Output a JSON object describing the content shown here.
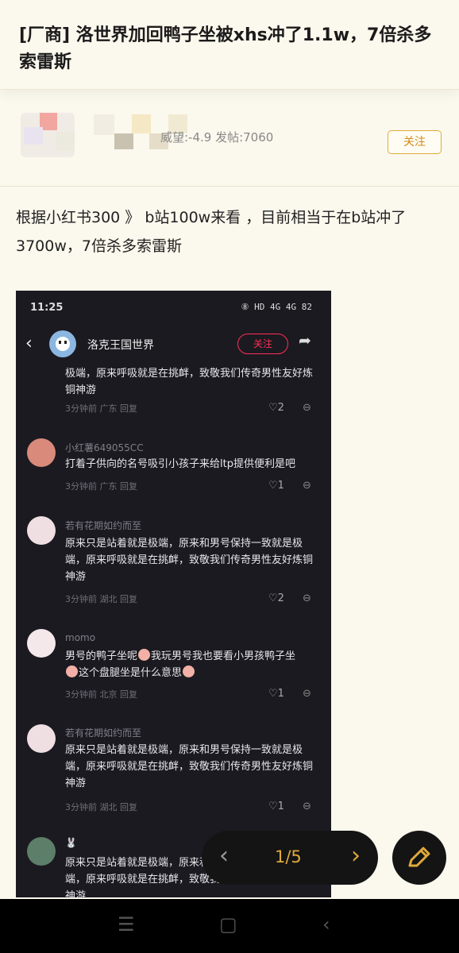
{
  "post": {
    "title": "[厂商] 洛世界加回鸭子坐被xhs冲了1.1w，7倍杀多索雷斯",
    "author_meta": "威望:-4.9 发帖:7060",
    "follow_label": "关注",
    "body": "根据小红书300 》 b站100w来看 ，目前相当于在b站冲了3700w，7倍杀多索雷斯"
  },
  "screenshot": {
    "time": "11:25",
    "status_icons": "⑧ HD 4G 4G 82",
    "account_name": "洛克王国世界",
    "follow_label": "关注",
    "comments": [
      {
        "name": "",
        "text": "极端，原来呼吸就是在挑衅，致敬我们传奇男性友好炼铜神游",
        "meta": "3分钟前 广东 回复",
        "likes": "♡2"
      },
      {
        "name": "小红薯649055CC",
        "text": "打着子供向的名号吸引小孩子来给ltp提供便利是吧",
        "meta": "3分钟前 广东 回复",
        "likes": "♡1"
      },
      {
        "name": "若有花期如约而至",
        "text": "原来只是站着就是极端，原来和男号保持一致就是极端，原来呼吸就是在挑衅，致敬我们传奇男性友好炼铜神游",
        "meta": "3分钟前 湖北 回复",
        "likes": "♡2"
      },
      {
        "name": "momo",
        "text_parts": [
          "男号的鸭子坐呢",
          "我玩男号我也要看小男孩鸭子坐",
          "这个盘腿坐是什么意思"
        ],
        "meta": "3分钟前 北京 回复",
        "likes": "♡1"
      },
      {
        "name": "若有花期如约而至",
        "text": "原来只是站着就是极端，原来和男号保持一致就是极端，原来呼吸就是在挑衅，致敬我们传奇男性友好炼铜神游",
        "meta": "3分钟前 湖北 回复",
        "likes": "♡1"
      },
      {
        "name": "🐰",
        "text": "原来只是站着就是极端，原来和男号保持一致就是极端，原来呼吸就是在挑衅，致敬我们传奇男性友好炼铜神游",
        "meta": "",
        "likes": ""
      }
    ]
  },
  "pager": {
    "text": "1/5",
    "prev_icon": "chevron-left-icon",
    "next_icon": "chevron-right-icon"
  },
  "edit_icon": "pencil-icon",
  "navbar": {
    "menu_icon": "menu-icon",
    "home_icon": "square-icon",
    "back_icon": "back-icon"
  },
  "colors": {
    "accent": "#e0a93a",
    "page_bg": "#fbf8ed",
    "red": "#ff2e54"
  }
}
